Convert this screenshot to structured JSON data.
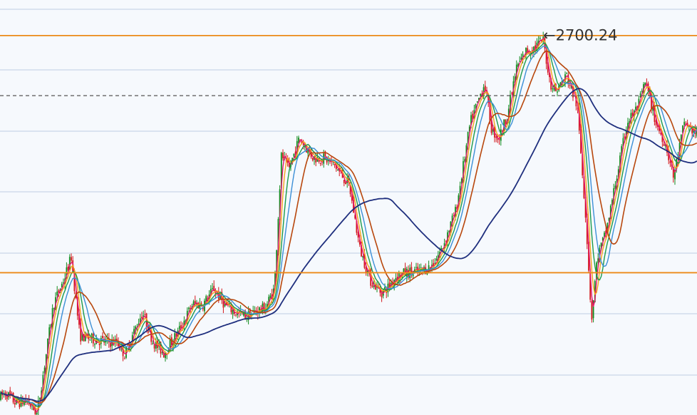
{
  "chart_data": {
    "type": "candlestick",
    "title": "",
    "xlabel": "",
    "ylabel": "",
    "ylim": [
      2220,
      2745
    ],
    "grid": true,
    "levels": {
      "upper_line": 2700,
      "lower_line": 2400,
      "dashed_line": 2624,
      "label_price": 2700.24,
      "label_text": "←2700.24"
    },
    "price_path": {
      "x": [
        0,
        8,
        22,
        38,
        52,
        62,
        75,
        90,
        100,
        112,
        120,
        135,
        150,
        165,
        175,
        190,
        200,
        215,
        230,
        250,
        270,
        285,
        300,
        315,
        330,
        345,
        360,
        372,
        385,
        395,
        405,
        420,
        440,
        455,
        470,
        490,
        505,
        520,
        535,
        545,
        555,
        570,
        590,
        605,
        620,
        640,
        660,
        680,
        690,
        700,
        712,
        725,
        738,
        750,
        762,
        772,
        780,
        795,
        810,
        822,
        830,
        838,
        850,
        865,
        880,
        895,
        905,
        912,
        920,
        935,
        945,
        960,
        978
      ],
      "y": [
        2242,
        2248,
        2235,
        2238,
        2222,
        2280,
        2360,
        2392,
        2420,
        2320,
        2318,
        2315,
        2312,
        2312,
        2296,
        2330,
        2350,
        2312,
        2298,
        2325,
        2360,
        2360,
        2380,
        2360,
        2350,
        2345,
        2352,
        2355,
        2380,
        2550,
        2530,
        2570,
        2545,
        2545,
        2535,
        2510,
        2430,
        2390,
        2375,
        2382,
        2395,
        2400,
        2402,
        2408,
        2430,
        2480,
        2590,
        2640,
        2580,
        2570,
        2600,
        2660,
        2680,
        2685,
        2695,
        2640,
        2630,
        2650,
        2610,
        2470,
        2340,
        2420,
        2450,
        2520,
        2590,
        2610,
        2640,
        2620,
        2590,
        2560,
        2520,
        2590,
        2575
      ]
    },
    "series": [
      {
        "name": "",
        "color": "#e4166b",
        "width": 1.4,
        "period": 3
      },
      {
        "name": "",
        "color": "#f5a31a",
        "width": 1.4,
        "period": 5
      },
      {
        "name": "",
        "color": "#1c9a4a",
        "width": 1.4,
        "period": 8
      },
      {
        "name": "",
        "color": "#3c8fd6",
        "width": 1.4,
        "period": 12
      },
      {
        "name": "",
        "color": "#b8470d",
        "width": 1.6,
        "period": 20
      },
      {
        "name": "",
        "color": "#1f2f7e",
        "width": 1.8,
        "period": 72
      }
    ],
    "colors": {
      "up": "#138a1e",
      "down": "#d3161b",
      "level": "#ec8a17",
      "dashed": "#555555",
      "label": "#333333",
      "grid": "#c9d6e8"
    }
  }
}
